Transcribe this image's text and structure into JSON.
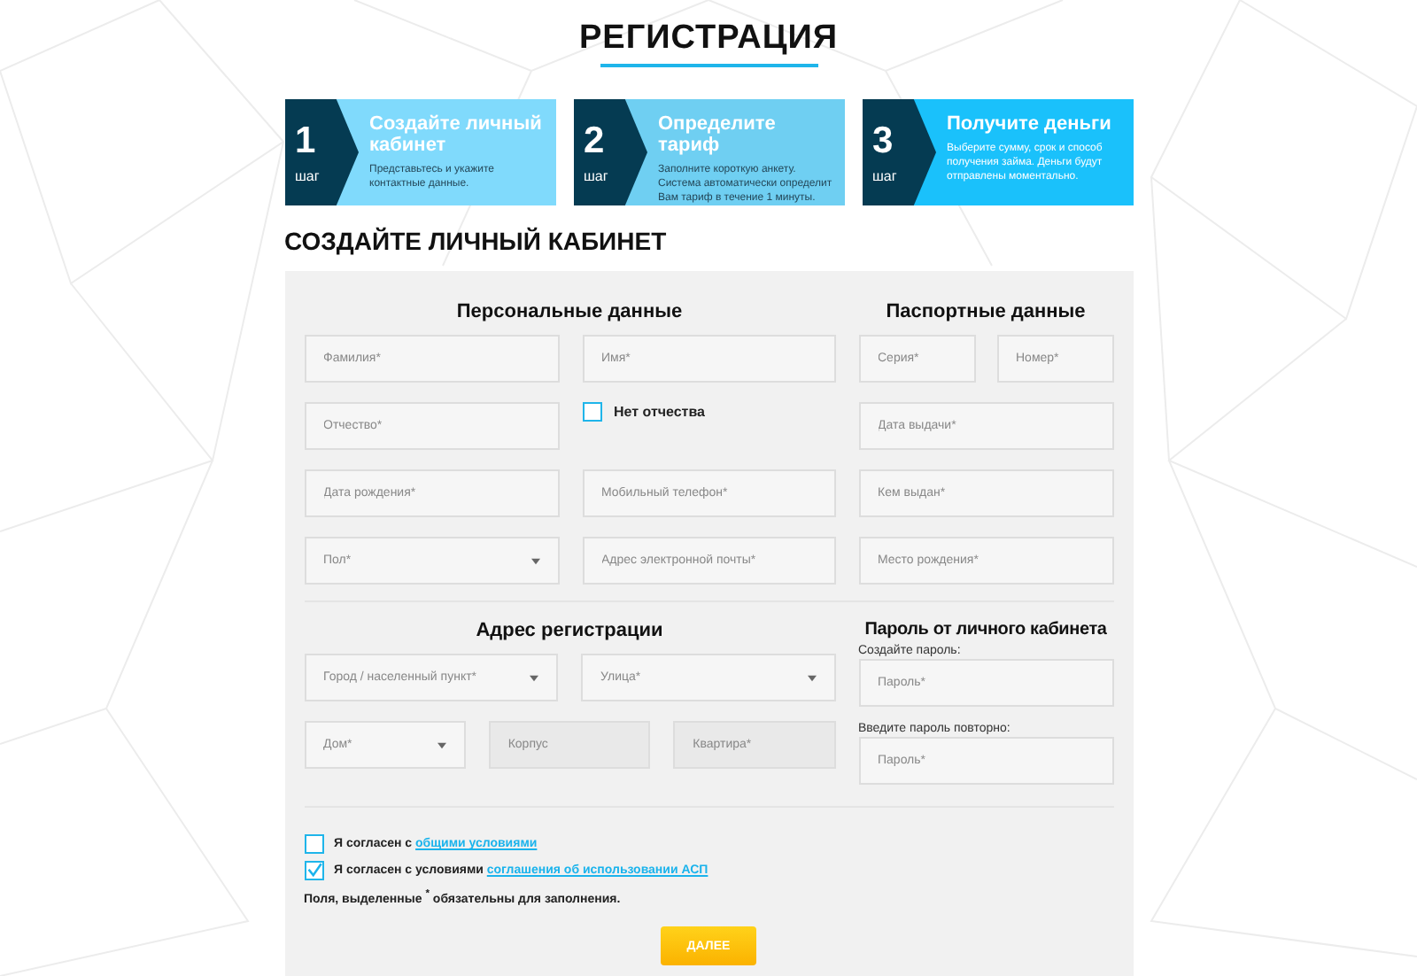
{
  "title": "РЕГИСТРАЦИЯ",
  "steps": [
    {
      "number": "1",
      "word": "шаг",
      "title": "Создайте личный кабинет",
      "text": "Представьтесь и укажите контактные данные.",
      "color": "#80dafc"
    },
    {
      "number": "2",
      "word": "шаг",
      "title": "Определите тариф",
      "text": "Заполните короткую анкету. Система автоматически определит Вам тариф в течение 1 минуты.",
      "color": "#6fcff2"
    },
    {
      "number": "3",
      "word": "шаг",
      "title": "Получите деньги",
      "text": "Выберите сумму, срок и способ получения займа. Деньги будут отправлены моментально.",
      "color": "#1ac1fb"
    }
  ],
  "section_title": "СОЗДАЙТЕ ЛИЧНЫЙ КАБИНЕТ",
  "personal": {
    "heading": "Персональные данные",
    "fields": [
      {
        "kind": "input",
        "placeholder": "Фамилия*"
      },
      {
        "kind": "input",
        "placeholder": "Имя*"
      },
      {
        "kind": "input",
        "placeholder": "Отчество*"
      },
      {
        "kind": "checkbox",
        "label": "Нет отчества",
        "checked": false
      },
      {
        "kind": "input",
        "placeholder": "Дата рождения*"
      },
      {
        "kind": "input",
        "placeholder": "Мобильный телефон*"
      },
      {
        "kind": "select",
        "placeholder": "Пол*"
      },
      {
        "kind": "input",
        "placeholder": "Адрес электронной почты*"
      }
    ]
  },
  "passport": {
    "heading": "Паспортные данные",
    "rows": [
      [
        {
          "placeholder": "Серия*"
        },
        {
          "placeholder": "Номер*"
        }
      ],
      [
        {
          "placeholder": "Дата выдачи*"
        }
      ],
      [
        {
          "placeholder": "Кем выдан*"
        }
      ],
      [
        {
          "placeholder": "Место рождения*"
        }
      ]
    ]
  },
  "address": {
    "heading": "Адрес регистрации",
    "rows": [
      [
        {
          "kind": "select",
          "placeholder": "Город / населенный пункт*",
          "disabled": false
        },
        {
          "kind": "select",
          "placeholder": "Улица*",
          "disabled": false
        }
      ],
      [
        {
          "kind": "select",
          "placeholder": "Дом*",
          "disabled": false
        },
        {
          "kind": "input",
          "placeholder": "Корпус",
          "disabled": true
        },
        {
          "kind": "input",
          "placeholder": "Квартира*",
          "disabled": true
        }
      ]
    ]
  },
  "password": {
    "heading": "Пароль от личного кабинета",
    "items": [
      {
        "label": "Создайте пароль:",
        "placeholder": "Пароль*"
      },
      {
        "label": "Введите пароль повторно:",
        "placeholder": "Пароль*"
      }
    ]
  },
  "agreements": [
    {
      "text": "Я согласен с",
      "link": "общими условиями",
      "checked": false
    },
    {
      "text": "Я согласен с условиями",
      "link": "соглашения об использовании АСП",
      "checked": true
    }
  ],
  "note": "Поля, выделенные $^{*}$ обязательны для заполнения.",
  "button": "ДАЛЕЕ"
}
